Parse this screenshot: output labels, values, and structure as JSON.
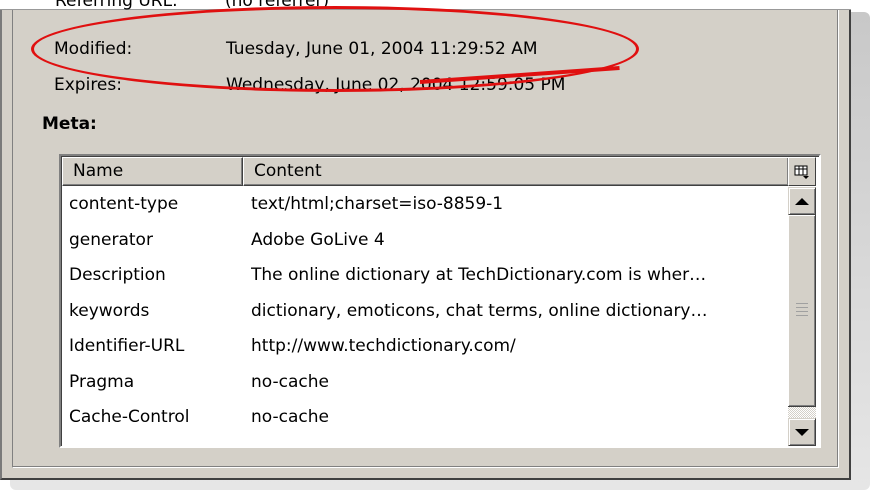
{
  "properties": {
    "referring_label": "Referring URL:",
    "referring_value": "(no referrer)",
    "modified_label": "Modified:",
    "modified_value": "Tuesday, June 01, 2004 11:29:52 AM",
    "expires_label": "Expires:",
    "expires_value": "Wednesday, June 02, 2004 12:59:05 PM"
  },
  "meta": {
    "section_label": "Meta:",
    "columns": [
      "Name",
      "Content"
    ],
    "column_picker_icon": "column-picker-icon",
    "rows": [
      {
        "name": "content-type",
        "content": "text/html;charset=iso-8859-1"
      },
      {
        "name": "generator",
        "content": "Adobe GoLive 4"
      },
      {
        "name": "Description",
        "content": "The online dictionary at TechDictionary.com is wher…"
      },
      {
        "name": "keywords",
        "content": "dictionary, emoticons, chat terms, online dictionary…"
      },
      {
        "name": "Identifier-URL",
        "content": "http://www.techdictionary.com/"
      },
      {
        "name": "Pragma",
        "content": "no-cache"
      },
      {
        "name": "Cache-Control",
        "content": "no-cache"
      }
    ]
  },
  "annotation_color": "#e01010"
}
